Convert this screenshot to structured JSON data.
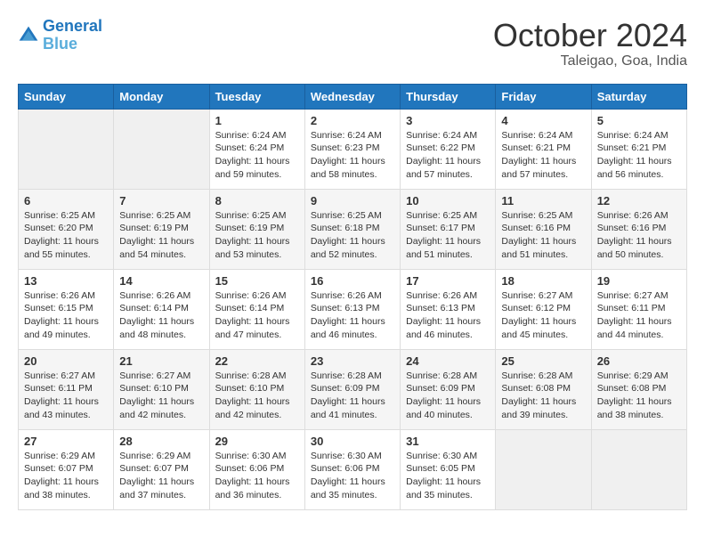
{
  "logo": {
    "line1": "General",
    "line2": "Blue"
  },
  "title": "October 2024",
  "subtitle": "Taleigao, Goa, India",
  "days_of_week": [
    "Sunday",
    "Monday",
    "Tuesday",
    "Wednesday",
    "Thursday",
    "Friday",
    "Saturday"
  ],
  "weeks": [
    [
      {
        "day": "",
        "info": ""
      },
      {
        "day": "",
        "info": ""
      },
      {
        "day": "1",
        "info": "Sunrise: 6:24 AM\nSunset: 6:24 PM\nDaylight: 11 hours and 59 minutes."
      },
      {
        "day": "2",
        "info": "Sunrise: 6:24 AM\nSunset: 6:23 PM\nDaylight: 11 hours and 58 minutes."
      },
      {
        "day": "3",
        "info": "Sunrise: 6:24 AM\nSunset: 6:22 PM\nDaylight: 11 hours and 57 minutes."
      },
      {
        "day": "4",
        "info": "Sunrise: 6:24 AM\nSunset: 6:21 PM\nDaylight: 11 hours and 57 minutes."
      },
      {
        "day": "5",
        "info": "Sunrise: 6:24 AM\nSunset: 6:21 PM\nDaylight: 11 hours and 56 minutes."
      }
    ],
    [
      {
        "day": "6",
        "info": "Sunrise: 6:25 AM\nSunset: 6:20 PM\nDaylight: 11 hours and 55 minutes."
      },
      {
        "day": "7",
        "info": "Sunrise: 6:25 AM\nSunset: 6:19 PM\nDaylight: 11 hours and 54 minutes."
      },
      {
        "day": "8",
        "info": "Sunrise: 6:25 AM\nSunset: 6:19 PM\nDaylight: 11 hours and 53 minutes."
      },
      {
        "day": "9",
        "info": "Sunrise: 6:25 AM\nSunset: 6:18 PM\nDaylight: 11 hours and 52 minutes."
      },
      {
        "day": "10",
        "info": "Sunrise: 6:25 AM\nSunset: 6:17 PM\nDaylight: 11 hours and 51 minutes."
      },
      {
        "day": "11",
        "info": "Sunrise: 6:25 AM\nSunset: 6:16 PM\nDaylight: 11 hours and 51 minutes."
      },
      {
        "day": "12",
        "info": "Sunrise: 6:26 AM\nSunset: 6:16 PM\nDaylight: 11 hours and 50 minutes."
      }
    ],
    [
      {
        "day": "13",
        "info": "Sunrise: 6:26 AM\nSunset: 6:15 PM\nDaylight: 11 hours and 49 minutes."
      },
      {
        "day": "14",
        "info": "Sunrise: 6:26 AM\nSunset: 6:14 PM\nDaylight: 11 hours and 48 minutes."
      },
      {
        "day": "15",
        "info": "Sunrise: 6:26 AM\nSunset: 6:14 PM\nDaylight: 11 hours and 47 minutes."
      },
      {
        "day": "16",
        "info": "Sunrise: 6:26 AM\nSunset: 6:13 PM\nDaylight: 11 hours and 46 minutes."
      },
      {
        "day": "17",
        "info": "Sunrise: 6:26 AM\nSunset: 6:13 PM\nDaylight: 11 hours and 46 minutes."
      },
      {
        "day": "18",
        "info": "Sunrise: 6:27 AM\nSunset: 6:12 PM\nDaylight: 11 hours and 45 minutes."
      },
      {
        "day": "19",
        "info": "Sunrise: 6:27 AM\nSunset: 6:11 PM\nDaylight: 11 hours and 44 minutes."
      }
    ],
    [
      {
        "day": "20",
        "info": "Sunrise: 6:27 AM\nSunset: 6:11 PM\nDaylight: 11 hours and 43 minutes."
      },
      {
        "day": "21",
        "info": "Sunrise: 6:27 AM\nSunset: 6:10 PM\nDaylight: 11 hours and 42 minutes."
      },
      {
        "day": "22",
        "info": "Sunrise: 6:28 AM\nSunset: 6:10 PM\nDaylight: 11 hours and 42 minutes."
      },
      {
        "day": "23",
        "info": "Sunrise: 6:28 AM\nSunset: 6:09 PM\nDaylight: 11 hours and 41 minutes."
      },
      {
        "day": "24",
        "info": "Sunrise: 6:28 AM\nSunset: 6:09 PM\nDaylight: 11 hours and 40 minutes."
      },
      {
        "day": "25",
        "info": "Sunrise: 6:28 AM\nSunset: 6:08 PM\nDaylight: 11 hours and 39 minutes."
      },
      {
        "day": "26",
        "info": "Sunrise: 6:29 AM\nSunset: 6:08 PM\nDaylight: 11 hours and 38 minutes."
      }
    ],
    [
      {
        "day": "27",
        "info": "Sunrise: 6:29 AM\nSunset: 6:07 PM\nDaylight: 11 hours and 38 minutes."
      },
      {
        "day": "28",
        "info": "Sunrise: 6:29 AM\nSunset: 6:07 PM\nDaylight: 11 hours and 37 minutes."
      },
      {
        "day": "29",
        "info": "Sunrise: 6:30 AM\nSunset: 6:06 PM\nDaylight: 11 hours and 36 minutes."
      },
      {
        "day": "30",
        "info": "Sunrise: 6:30 AM\nSunset: 6:06 PM\nDaylight: 11 hours and 35 minutes."
      },
      {
        "day": "31",
        "info": "Sunrise: 6:30 AM\nSunset: 6:05 PM\nDaylight: 11 hours and 35 minutes."
      },
      {
        "day": "",
        "info": ""
      },
      {
        "day": "",
        "info": ""
      }
    ]
  ]
}
